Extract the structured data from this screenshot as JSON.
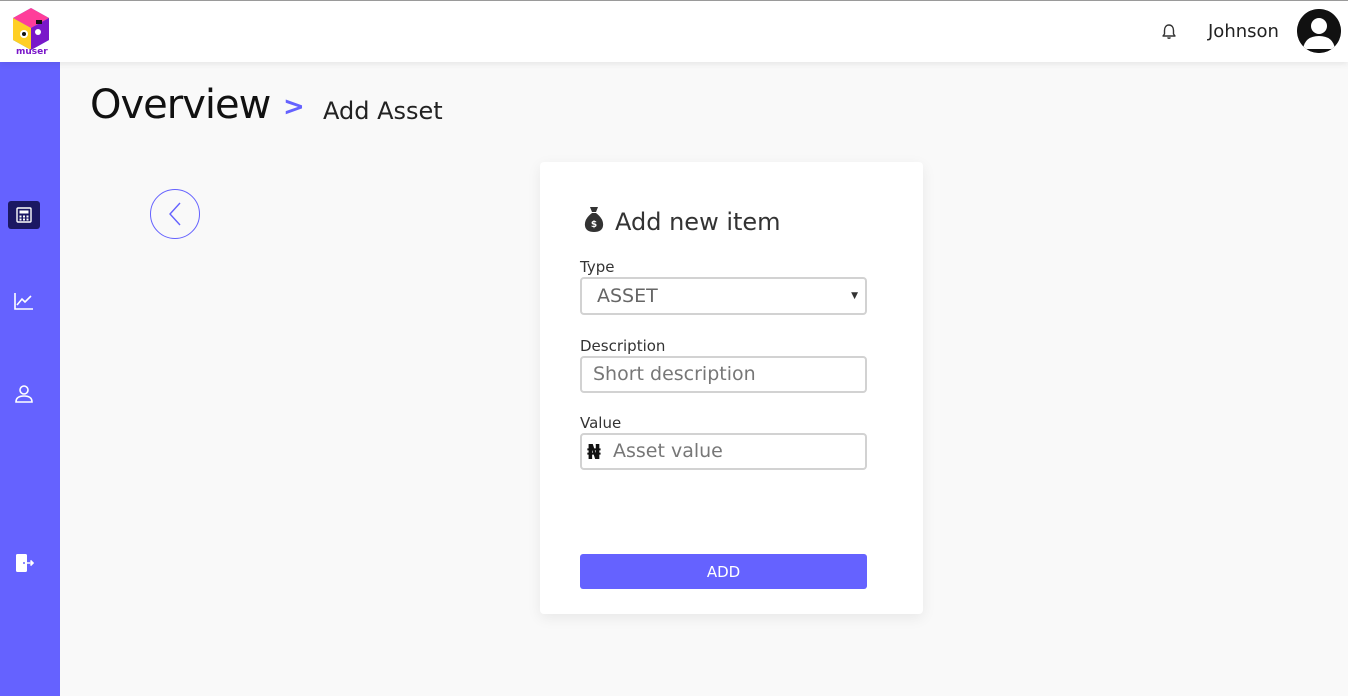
{
  "header": {
    "logo_text": "muser",
    "username": "Johnson"
  },
  "sidebar": {
    "items": [
      {
        "icon": "calculator-icon",
        "active": true
      },
      {
        "icon": "chart-line-icon",
        "active": false
      },
      {
        "icon": "user-icon",
        "active": false
      },
      {
        "icon": "logout-icon",
        "active": false
      }
    ]
  },
  "breadcrumb": {
    "title": "Overview",
    "separator": ">",
    "current": "Add Asset"
  },
  "form": {
    "title": "Add new item",
    "type_label": "Type",
    "type_value": "ASSET",
    "description_label": "Description",
    "description_placeholder": "Short description",
    "value_label": "Value",
    "currency_symbol": "₦",
    "value_placeholder": "Asset value",
    "submit_label": "ADD"
  },
  "colors": {
    "accent": "#6562ff",
    "sidebar_active": "#1b1863"
  }
}
